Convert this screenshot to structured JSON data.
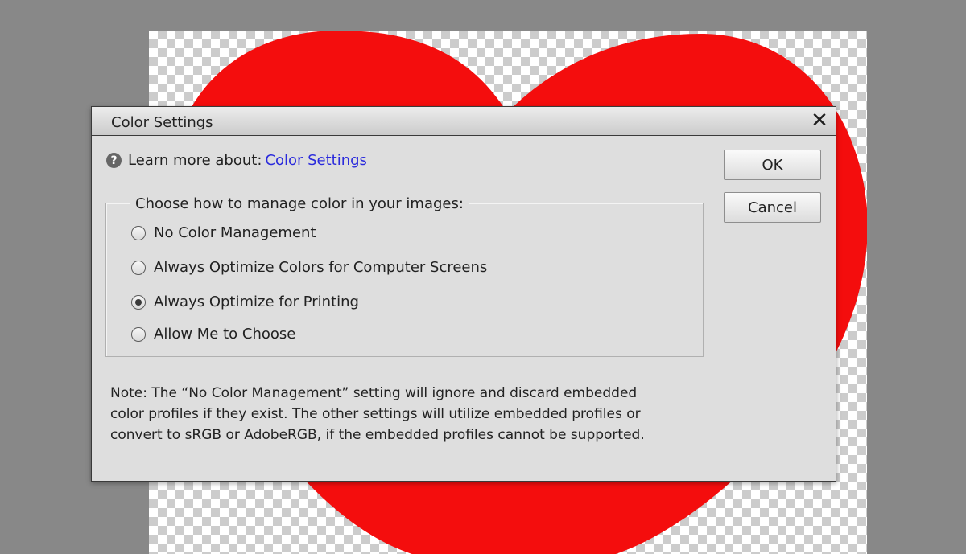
{
  "colors": {
    "workspace": "#888888",
    "heart": "#f40d0d",
    "link": "#2a2adc"
  },
  "dialog": {
    "title": "Color Settings",
    "close_icon": "close-x-icon",
    "help": {
      "icon": "question-circle-icon",
      "text": "Learn more about:",
      "link": "Color Settings"
    },
    "buttons": {
      "ok": "OK",
      "cancel": "Cancel"
    },
    "group": {
      "legend": "Choose how to manage color in your images:",
      "options": [
        {
          "label": "No Color Management",
          "checked": false
        },
        {
          "label": "Always Optimize Colors for Computer Screens",
          "checked": false
        },
        {
          "label": "Always Optimize for Printing",
          "checked": true
        },
        {
          "label": "Allow Me to Choose",
          "checked": false
        }
      ]
    },
    "note_lines": [
      "Note: The “No Color Management” setting will ignore and discard embedded",
      "color profiles if they exist. The other settings will utilize embedded profiles or",
      "convert to sRGB or AdobeRGB, if the embedded profiles cannot be supported."
    ]
  }
}
